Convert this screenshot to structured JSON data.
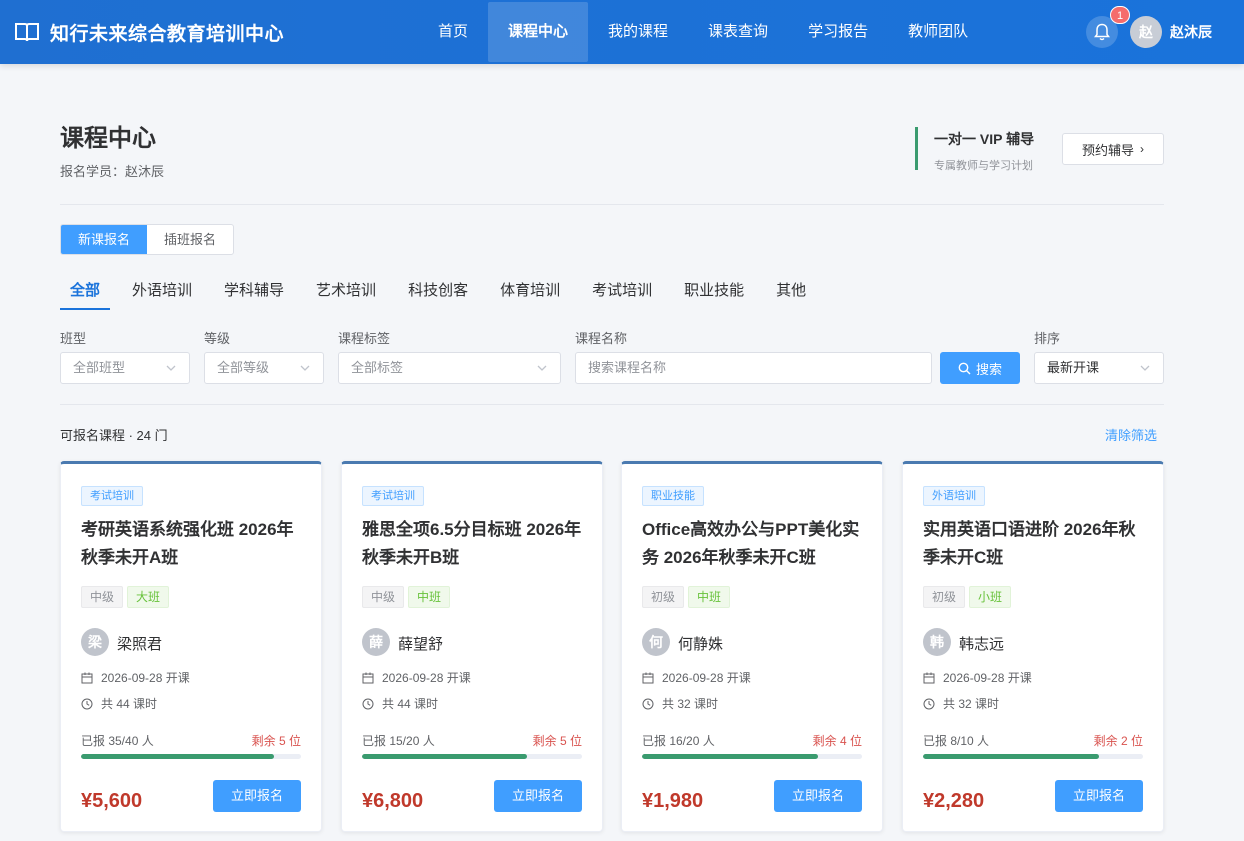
{
  "header": {
    "brand": "知行未来综合教育培训中心",
    "nav": [
      {
        "label": "首页",
        "active": false
      },
      {
        "label": "课程中心",
        "active": true
      },
      {
        "label": "我的课程",
        "active": false
      },
      {
        "label": "课表查询",
        "active": false
      },
      {
        "label": "学习报告",
        "active": false
      },
      {
        "label": "教师团队",
        "active": false
      }
    ],
    "notification_count": "1",
    "user_avatar": "赵",
    "user_name": "赵沐辰"
  },
  "page": {
    "title": "课程中心",
    "subtitle": "报名学员：赵沐辰",
    "vip_title": "一对一 VIP 辅导",
    "vip_subtitle": "专属教师与学习计划",
    "vip_button": "预约辅导"
  },
  "enroll_types": [
    {
      "label": "新课报名",
      "active": true
    },
    {
      "label": "插班报名",
      "active": false
    }
  ],
  "categories": [
    {
      "label": "全部",
      "active": true
    },
    {
      "label": "外语培训",
      "active": false
    },
    {
      "label": "学科辅导",
      "active": false
    },
    {
      "label": "艺术培训",
      "active": false
    },
    {
      "label": "科技创客",
      "active": false
    },
    {
      "label": "体育培训",
      "active": false
    },
    {
      "label": "考试培训",
      "active": false
    },
    {
      "label": "职业技能",
      "active": false
    },
    {
      "label": "其他",
      "active": false
    }
  ],
  "filters": {
    "class_type_label": "班型",
    "class_type_value": "全部班型",
    "level_label": "等级",
    "level_value": "全部等级",
    "tag_label": "课程标签",
    "tag_value": "全部标签",
    "name_label": "课程名称",
    "name_placeholder": "搜索课程名称",
    "search_button": "搜索",
    "sort_label": "排序",
    "sort_value": "最新开课"
  },
  "results": {
    "count_text": "可报名课程 · 24 门",
    "clear_text": "清除筛选"
  },
  "courses": [
    {
      "category": "考试培训",
      "name": "考研英语系统强化班 2026年秋季未开A班",
      "level": "中级",
      "size": "大班",
      "teacher_initial": "梁",
      "teacher": "梁照君",
      "start": "2026-09-28 开课",
      "hours": "共 44 课时",
      "enrolled_text": "已报 35/40 人",
      "remain_text": "剩余 5 位",
      "fill_ratio": 0.875,
      "price": "¥5,600",
      "button": "立即报名"
    },
    {
      "category": "考试培训",
      "name": "雅思全项6.5分目标班 2026年秋季未开B班",
      "level": "中级",
      "size": "中班",
      "teacher_initial": "薛",
      "teacher": "薛望舒",
      "start": "2026-09-28 开课",
      "hours": "共 44 课时",
      "enrolled_text": "已报 15/20 人",
      "remain_text": "剩余 5 位",
      "fill_ratio": 0.75,
      "price": "¥6,800",
      "button": "立即报名"
    },
    {
      "category": "职业技能",
      "name": "Office高效办公与PPT美化实务 2026年秋季未开C班",
      "level": "初级",
      "size": "中班",
      "teacher_initial": "何",
      "teacher": "何静姝",
      "start": "2026-09-28 开课",
      "hours": "共 32 课时",
      "enrolled_text": "已报 16/20 人",
      "remain_text": "剩余 4 位",
      "fill_ratio": 0.8,
      "price": "¥1,980",
      "button": "立即报名"
    },
    {
      "category": "外语培训",
      "name": "实用英语口语进阶 2026年秋季未开C班",
      "level": "初级",
      "size": "小班",
      "teacher_initial": "韩",
      "teacher": "韩志远",
      "start": "2026-09-28 开课",
      "hours": "共 32 课时",
      "enrolled_text": "已报 8/10 人",
      "remain_text": "剩余 2 位",
      "fill_ratio": 0.8,
      "price": "¥2,280",
      "button": "立即报名"
    }
  ],
  "colors": {
    "header_blue": "#1a73db",
    "primary": "#409eff",
    "price_red": "#c0392b",
    "progress_green": "#3a9b6f"
  }
}
